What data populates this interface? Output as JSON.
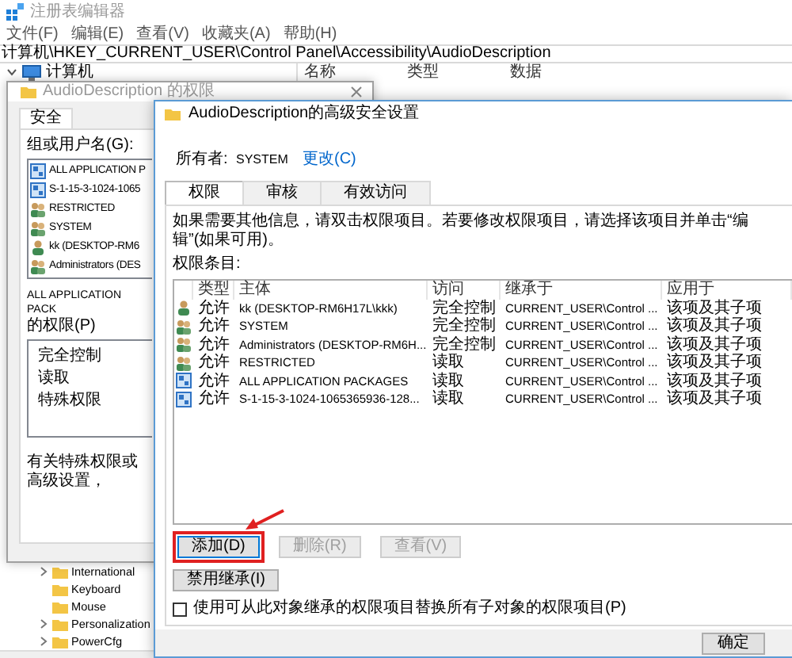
{
  "registry_editor": {
    "title": "注册表编辑器",
    "menu": [
      "文件(F)",
      "编辑(E)",
      "查看(V)",
      "收藏夹(A)",
      "帮助(H)"
    ],
    "address": "计算机\\HKEY_CURRENT_USER\\Control Panel\\Accessibility\\AudioDescription",
    "tree_root": {
      "label": "计算机",
      "expanded": true
    },
    "tree_items": [
      {
        "label": "International",
        "expandable": true
      },
      {
        "label": "Keyboard",
        "expandable": false
      },
      {
        "label": "Mouse",
        "expandable": false
      },
      {
        "label": "Personalization",
        "expandable": true
      },
      {
        "label": "PowerCfg",
        "expandable": true
      }
    ],
    "columns": [
      "名称",
      "类型",
      "数据"
    ]
  },
  "permission_dialog": {
    "title": "AudioDescription 的权限",
    "tabs": [
      {
        "label": "安全",
        "selected": true
      }
    ],
    "group_label": "组或用户名(G):",
    "users": [
      {
        "name": "ALL APPLICATION P",
        "kind": "package"
      },
      {
        "name": "S-1-15-3-1024-1065",
        "kind": "package"
      },
      {
        "name": "RESTRICTED",
        "kind": "group"
      },
      {
        "name": "SYSTEM",
        "kind": "group"
      },
      {
        "name": "kk (DESKTOP-RM6",
        "kind": "user"
      },
      {
        "name": "Administrators (DES",
        "kind": "group"
      }
    ],
    "permissions_label": [
      "ALL APPLICATION PACK",
      "的权限(P)"
    ],
    "permissions": [
      "完全控制",
      "读取",
      "特殊权限"
    ],
    "note": "有关特殊权限或高级设置，"
  },
  "advanced_dialog": {
    "title": "AudioDescription的高级安全设置",
    "owner_label": "所有者:",
    "owner": "SYSTEM",
    "change_link": "更改(C)",
    "tabs": [
      {
        "label": "权限",
        "selected": true
      },
      {
        "label": "审核",
        "selected": false
      },
      {
        "label": "有效访问",
        "selected": false
      }
    ],
    "info": "如果需要其他信息，请双击权限项目。若要修改权限项目，请选择该项目并单击“编辑”(如果可用)。",
    "entries_label": "权限条目:",
    "columns": [
      "类型",
      "主体",
      "访问",
      "继承于",
      "应用于"
    ],
    "entries": [
      {
        "kind": "user",
        "type": "允许",
        "principal": "kk (DESKTOP-RM6H17L\\kkk)",
        "access": "完全控制",
        "inherited_from": "CURRENT_USER\\Control ...",
        "applies_to": "该项及其子项"
      },
      {
        "kind": "group",
        "type": "允许",
        "principal": "SYSTEM",
        "access": "完全控制",
        "inherited_from": "CURRENT_USER\\Control ...",
        "applies_to": "该项及其子项"
      },
      {
        "kind": "group",
        "type": "允许",
        "principal": "Administrators (DESKTOP-RM6H...",
        "access": "完全控制",
        "inherited_from": "CURRENT_USER\\Control ...",
        "applies_to": "该项及其子项"
      },
      {
        "kind": "group",
        "type": "允许",
        "principal": "RESTRICTED",
        "access": "读取",
        "inherited_from": "CURRENT_USER\\Control ...",
        "applies_to": "该项及其子项"
      },
      {
        "kind": "package",
        "type": "允许",
        "principal": "ALL APPLICATION PACKAGES",
        "access": "读取",
        "inherited_from": "CURRENT_USER\\Control ...",
        "applies_to": "该项及其子项"
      },
      {
        "kind": "package",
        "type": "允许",
        "principal": "S-1-15-3-1024-1065365936-128...",
        "access": "读取",
        "inherited_from": "CURRENT_USER\\Control ...",
        "applies_to": "该项及其子项"
      }
    ],
    "buttons": [
      {
        "label": "添加(D)",
        "disabled": false,
        "highlighted": true
      },
      {
        "label": "删除(R)",
        "disabled": true,
        "highlighted": false
      },
      {
        "label": "查看(V)",
        "disabled": true,
        "highlighted": false
      }
    ],
    "disable_inheritance": "禁用继承(I)",
    "replace_checkbox": {
      "label": "使用可从此对象继承的权限项目替换所有子对象的权限项目(P)",
      "checked": false
    },
    "footer_buttons": [
      "确定"
    ]
  }
}
